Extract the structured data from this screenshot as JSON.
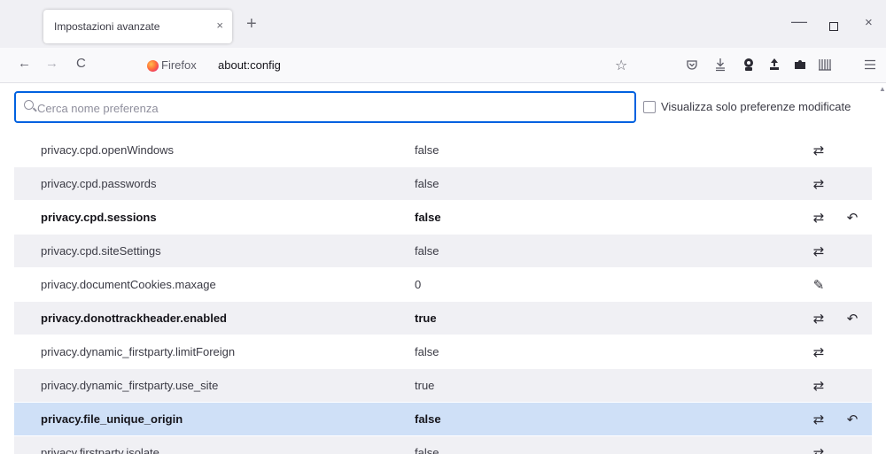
{
  "tab": {
    "title": "Impostazioni avanzate",
    "close": "×",
    "new_tab": "+"
  },
  "window": {
    "minimize": "—",
    "close": "×"
  },
  "nav": {
    "back": "←",
    "forward": "→",
    "reload": "C",
    "identity_label": "Firefox",
    "url": "about:config",
    "bookmark": "☆"
  },
  "toolbar_icons": [
    "pocket-icon",
    "downloads-icon",
    "account-icon",
    "extension-icon",
    "puzzle-icon",
    "library-icon",
    "menu-icon"
  ],
  "search": {
    "placeholder": "Cerca nome preferenza",
    "value": ""
  },
  "filter": {
    "label": "Visualizza solo preferenze modificate",
    "checked": false
  },
  "prefs": [
    {
      "name": "privacy.cpd.openWindows",
      "value": "false",
      "modified": false,
      "action": "⇄"
    },
    {
      "name": "privacy.cpd.passwords",
      "value": "false",
      "modified": false,
      "action": "⇄"
    },
    {
      "name": "privacy.cpd.sessions",
      "value": "false",
      "modified": true,
      "action": "⇄",
      "reset": "↶"
    },
    {
      "name": "privacy.cpd.siteSettings",
      "value": "false",
      "modified": false,
      "action": "⇄"
    },
    {
      "name": "privacy.documentCookies.maxage",
      "value": "0",
      "modified": false,
      "action": "✎"
    },
    {
      "name": "privacy.donottrackheader.enabled",
      "value": "true",
      "modified": true,
      "action": "⇄",
      "reset": "↶"
    },
    {
      "name": "privacy.dynamic_firstparty.limitForeign",
      "value": "false",
      "modified": false,
      "action": "⇄"
    },
    {
      "name": "privacy.dynamic_firstparty.use_site",
      "value": "true",
      "modified": false,
      "action": "⇄"
    },
    {
      "name": "privacy.file_unique_origin",
      "value": "false",
      "modified": true,
      "selected": true,
      "action": "⇄",
      "reset": "↶"
    },
    {
      "name": "privacy.firstparty.isolate",
      "value": "false",
      "modified": false,
      "action": "⇄"
    }
  ]
}
